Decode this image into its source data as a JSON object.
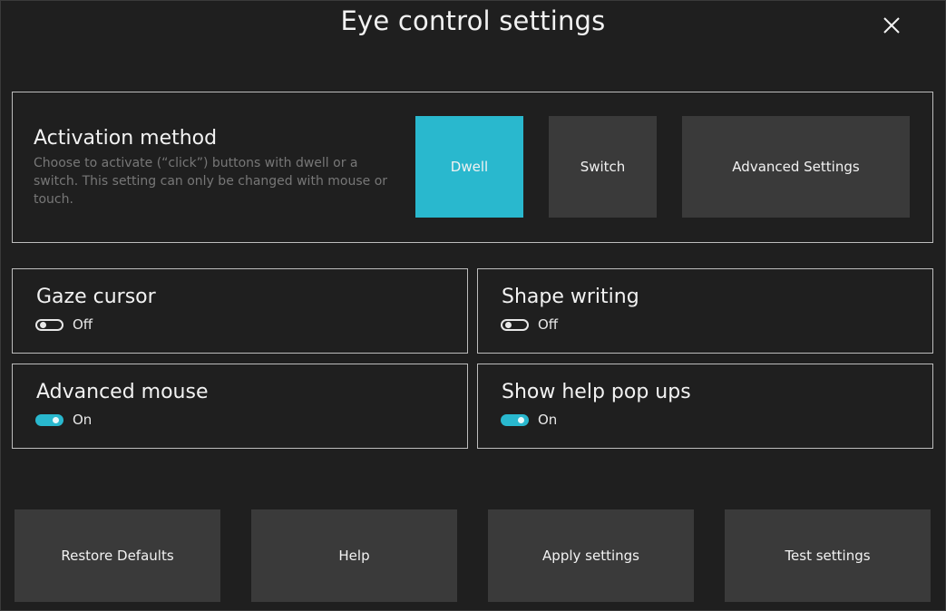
{
  "window": {
    "title": "Eye control settings",
    "close_icon": "close-icon"
  },
  "activation": {
    "title": "Activation method",
    "description": "Choose to activate (“click”) buttons with dwell or a switch. This setting can only be changed with mouse or touch.",
    "options": [
      "Dwell",
      "Switch",
      "Advanced Settings"
    ],
    "selected": "Dwell",
    "accent_color": "#29b8ce"
  },
  "settings": {
    "gaze_cursor": {
      "title": "Gaze cursor",
      "state": "Off"
    },
    "shape_writing": {
      "title": "Shape writing",
      "state": "Off"
    },
    "advanced_mouse": {
      "title": "Advanced mouse",
      "state": "On"
    },
    "help_popups": {
      "title": "Show help pop ups",
      "state": "On"
    }
  },
  "footer": {
    "buttons": [
      "Restore Defaults",
      "Help",
      "Apply settings",
      "Test settings"
    ]
  }
}
